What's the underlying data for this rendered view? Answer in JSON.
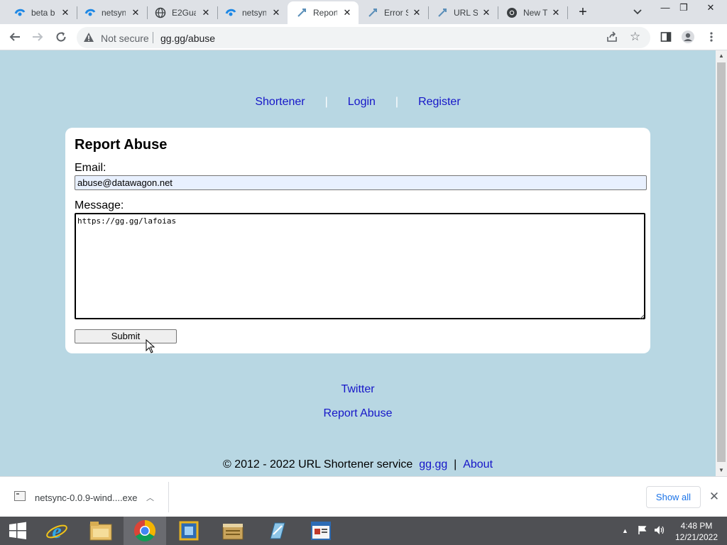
{
  "browser": {
    "tabs": [
      {
        "title": "beta b",
        "icon": "netsync-logo-icon"
      },
      {
        "title": "netsyn",
        "icon": "netsync-logo-icon"
      },
      {
        "title": "E2Gua",
        "icon": "globe-icon"
      },
      {
        "title": "netsyn",
        "icon": "netsync-logo-icon"
      },
      {
        "title": "Report",
        "icon": "shortener-icon"
      },
      {
        "title": "Error S",
        "icon": "shortener-icon"
      },
      {
        "title": "URL Sh",
        "icon": "shortener-icon"
      },
      {
        "title": "New T",
        "icon": "chrome-icon"
      }
    ],
    "active_tab_index": 4,
    "security_label": "Not secure",
    "url": "gg.gg/abuse"
  },
  "page": {
    "nav": {
      "shortener": "Shortener",
      "login": "Login",
      "register": "Register",
      "separator": "|"
    },
    "form": {
      "title": "Report Abuse",
      "email_label": "Email:",
      "email_value": "abuse@datawagon.net",
      "message_label": "Message:",
      "message_value": "https://gg.gg/lafoias",
      "submit_label": "Submit"
    },
    "footer": {
      "twitter": "Twitter",
      "report_abuse": "Report Abuse",
      "copyright": "© 2012 - 2022 URL Shortener service",
      "site_link": "gg.gg",
      "separator": "|",
      "about": "About"
    }
  },
  "downloads": {
    "file_name": "netsync-0.0.9-wind....exe",
    "show_all": "Show all"
  },
  "taskbar": {
    "time": "4:48 PM",
    "date": "12/21/2022"
  },
  "colors": {
    "page_bg": "#b8d7e3",
    "link": "#1616c8",
    "autofill_bg": "#e8f0fe",
    "taskbar_bg": "#4f5054"
  }
}
